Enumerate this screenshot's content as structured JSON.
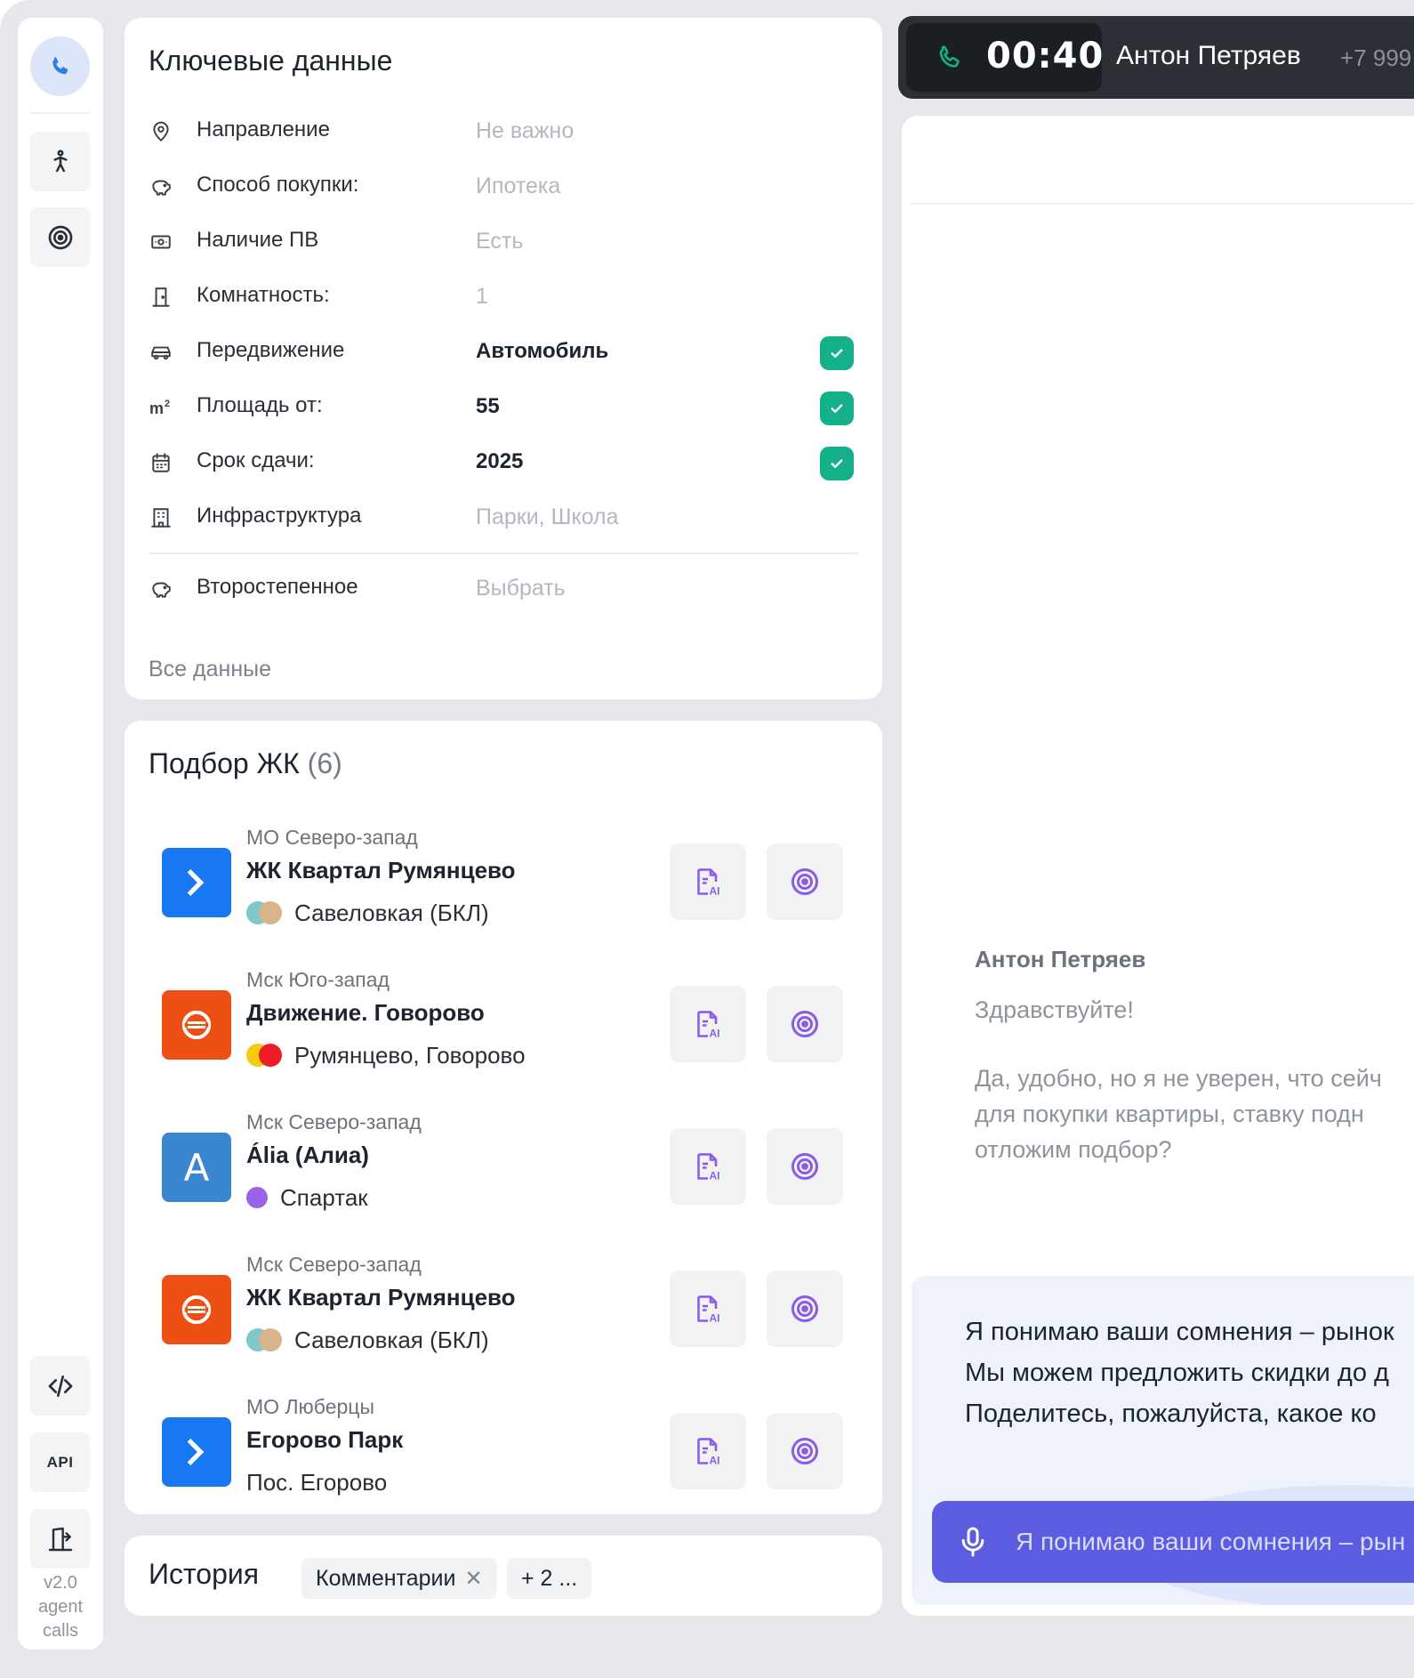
{
  "sidebar": {
    "api_label": "API",
    "version_lines": [
      "v2.0",
      "agent",
      "calls"
    ]
  },
  "key_data": {
    "title": "Ключевые данные",
    "rows": [
      {
        "icon": "location-pin-icon",
        "label": "Направление",
        "value": "Не важно",
        "filled": false,
        "checked": false
      },
      {
        "icon": "piggy-bank-icon",
        "label": "Способ покупки:",
        "value": "Ипотека",
        "filled": false,
        "checked": false
      },
      {
        "icon": "money-icon",
        "label": "Наличие ПВ",
        "value": "Есть",
        "filled": false,
        "checked": false
      },
      {
        "icon": "door-icon",
        "label": "Комнатность:",
        "value": "1",
        "filled": false,
        "checked": false
      },
      {
        "icon": "car-icon",
        "label": "Передвижение",
        "value": "Автомобиль",
        "filled": true,
        "checked": true
      },
      {
        "icon": "area-m2-icon",
        "label": "Площадь от:",
        "value": "55",
        "filled": true,
        "checked": true
      },
      {
        "icon": "calendar-icon",
        "label": "Срок сдачи:",
        "value": "2025",
        "filled": true,
        "checked": true
      },
      {
        "icon": "building-icon",
        "label": "Инфраструктура",
        "value": "Парки, Школа",
        "filled": false,
        "checked": false
      }
    ],
    "secondary": {
      "icon": "piggy-bank-icon",
      "label": "Второстепенное",
      "value": "Выбрать"
    },
    "all_data_link": "Все данные"
  },
  "zk": {
    "title": "Подбор ЖК",
    "count": "(6)",
    "items": [
      {
        "region": "МО Северо-запад",
        "name": "ЖК Квартал Румянцево",
        "metro": "Савеловкая (БКЛ)",
        "logo": "arrow-logo-icon",
        "logo_color": "#1877f2",
        "dots": [
          "#7fc7c9",
          "#d7b48a"
        ]
      },
      {
        "region": "Мск Юго-запад",
        "name": "Движение. Говорово",
        "metro": "Румянцево, Говорово",
        "logo": "s-logo-icon",
        "logo_color": "#ee4f15",
        "dots": [
          "#f3cc10",
          "#ee1c25"
        ]
      },
      {
        "region": "Мск Северо-запад",
        "name": "Ália (Алиа)",
        "metro": "Спартак",
        "logo": "a-logo-icon",
        "logo_color": "#3a86d0",
        "dots": [
          "#9a63e8"
        ]
      },
      {
        "region": "Мск Северо-запад",
        "name": "ЖК Квартал Румянцево",
        "metro": "Савеловкая (БКЛ)",
        "logo": "s-logo-icon",
        "logo_color": "#ee4f15",
        "dots": [
          "#7fc7c9",
          "#d7b48a"
        ]
      },
      {
        "region": "МО Люберцы",
        "name": "Егорово Парк",
        "metro": "Пос. Егорово",
        "logo": "arrow-logo-icon",
        "logo_color": "#1877f2",
        "dots": []
      }
    ],
    "logo_letter": "A"
  },
  "history": {
    "title": "История",
    "chips": [
      {
        "label": "Комментарии",
        "removable": true
      },
      {
        "label": "+ 2 ...",
        "removable": false
      }
    ]
  },
  "call": {
    "timer": "00:40",
    "caller_name": "Антон Петряев",
    "caller_phone": "+7 999"
  },
  "chat": {
    "author": "Антон Петряев",
    "greeting": "Здравствуйте!",
    "message_lines": [
      "Да, удобно, но я не уверен, что сейч",
      "для покупки квартиры, ставку подн",
      "отложим подбор?"
    ],
    "suggestion_lines": [
      "Я понимаю ваши сомнения – рынок",
      "Мы можем предложить скидки до д",
      "Поделитесь, пожалуйста, какое ко"
    ],
    "voice_text": "Я понимаю ваши сомнения – рын"
  },
  "colors": {
    "accent_green": "#13b089",
    "accent_purple": "#8a5be6",
    "voice_button": "#5b5ce0",
    "callbar": "#2b2f36"
  }
}
